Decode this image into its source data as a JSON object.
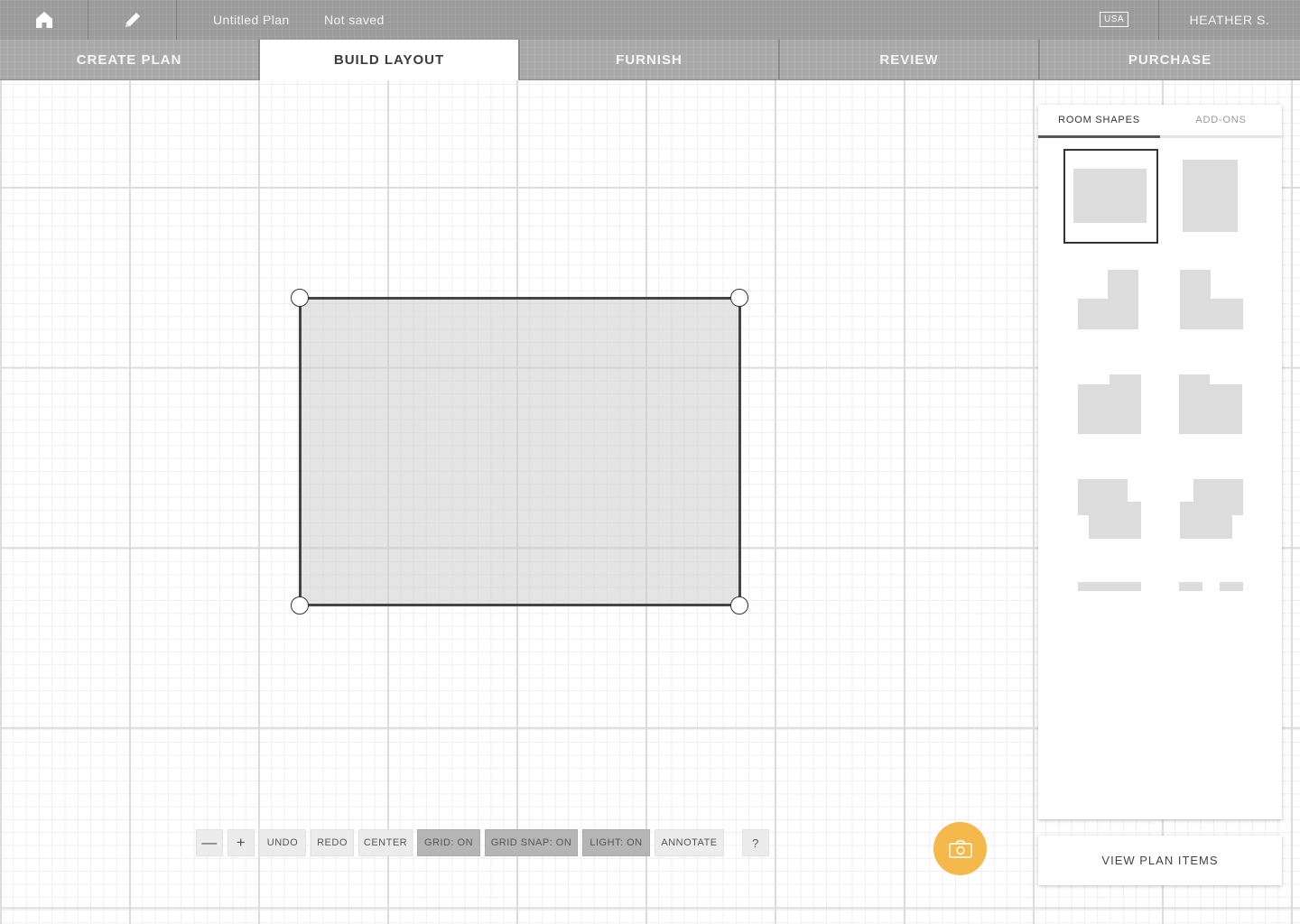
{
  "topbar": {
    "plan_name": "Untitled Plan",
    "save_state": "Not saved",
    "region_badge": "USA",
    "user_name": "HEATHER S.",
    "home_icon": "home-icon",
    "edit_icon": "pencil-icon"
  },
  "steps": [
    {
      "label": "CREATE PLAN",
      "active": false
    },
    {
      "label": "BUILD LAYOUT",
      "active": true
    },
    {
      "label": "FURNISH",
      "active": false
    },
    {
      "label": "REVIEW",
      "active": false
    },
    {
      "label": "PURCHASE",
      "active": false
    }
  ],
  "toolbar": {
    "zoom_out": "—",
    "zoom_in": "+",
    "undo": "UNDO",
    "redo": "REDO",
    "center": "CENTER",
    "grid": "GRID: ON",
    "grid_snap": "GRID SNAP: ON",
    "light": "LIGHT: ON",
    "annotate": "ANNOTATE",
    "help": "?"
  },
  "panel": {
    "tabs": [
      {
        "label": "ROOM SHAPES",
        "active": true
      },
      {
        "label": "ADD-ONS",
        "active": false
      }
    ],
    "shapes": [
      "rectangle-wide",
      "rectangle-tall",
      "l-shape-right",
      "l-shape-left",
      "notch-right",
      "notch-left",
      "offset-right",
      "offset-left",
      "wall",
      "wall-with-gap"
    ]
  },
  "camera_icon": "camera-icon",
  "view_plan_items": "VIEW PLAN ITEMS",
  "colors": {
    "accent": "#f5b84a",
    "topbar": "#9b9b9b",
    "room_fill": "#e0e0e0",
    "room_border": "#444444"
  }
}
